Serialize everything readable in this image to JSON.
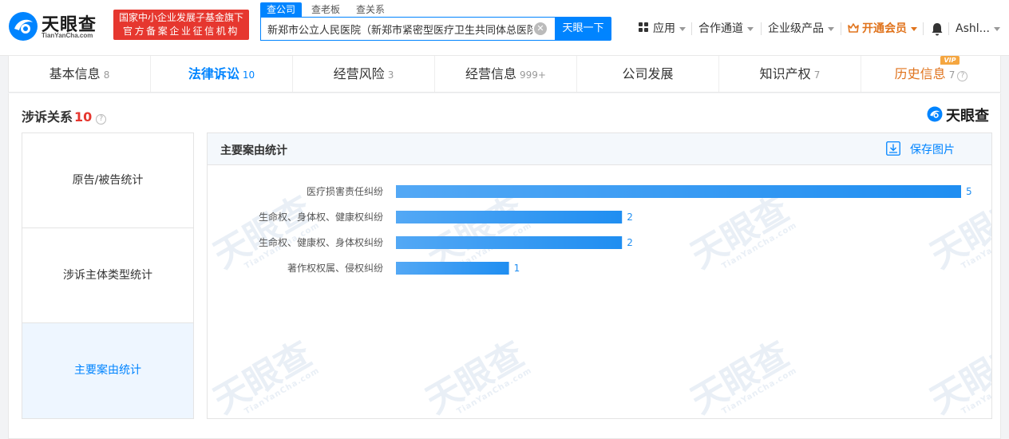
{
  "header": {
    "logo_text": "天眼查",
    "logo_sub": "TianYanCha.com",
    "gov_badge_line1": "国家中小企业发展子基金旗下",
    "gov_badge_line2": "官方备案企业征信机构",
    "search_tabs": [
      {
        "label": "查公司"
      },
      {
        "label": "查老板"
      },
      {
        "label": "查关系"
      }
    ],
    "search_value": "新郑市公立人民医院（新郑市紧密型医疗卫生共同体总医院）",
    "search_button": "天眼一下",
    "nav": {
      "apps": "应用",
      "cooperation": "合作通道",
      "enterprise": "企业级产品",
      "vip": "开通会员",
      "user": "Ashl..."
    }
  },
  "tabs": [
    {
      "label": "基本信息",
      "count": "8"
    },
    {
      "label": "法律诉讼",
      "count": "10"
    },
    {
      "label": "经营风险",
      "count": "3"
    },
    {
      "label": "经营信息",
      "count": "999+"
    },
    {
      "label": "公司发展",
      "count": ""
    },
    {
      "label": "知识产权",
      "count": "7"
    },
    {
      "label": "历史信息",
      "count": "7"
    }
  ],
  "vip_badge": "VIP",
  "section": {
    "title": "涉诉关系",
    "count": "10",
    "brand": "天眼查"
  },
  "side_items": [
    {
      "label": "原告/被告统计"
    },
    {
      "label": "涉诉主体类型统计"
    },
    {
      "label": "主要案由统计"
    }
  ],
  "chart_panel": {
    "title": "主要案由统计",
    "save_label": "保存图片"
  },
  "watermark": {
    "text": "天眼查",
    "sub": "TianYanCha.com"
  },
  "colors": {
    "brand_blue": "#0084ff",
    "bar_start": "#53a8f5",
    "bar_end": "#1f8ef1",
    "gov_red": "#e6372f",
    "vip_orange": "#e0731c"
  },
  "chart_data": {
    "type": "bar",
    "orientation": "horizontal",
    "categories": [
      "医疗损害责任纠纷",
      "生命权、身体权、健康权纠纷",
      "生命权、健康权、身体权纠纷",
      "著作权权属、侵权纠纷"
    ],
    "values": [
      5,
      2,
      2,
      1
    ],
    "xlim": [
      0,
      5
    ],
    "grid": false,
    "legend": "none"
  }
}
